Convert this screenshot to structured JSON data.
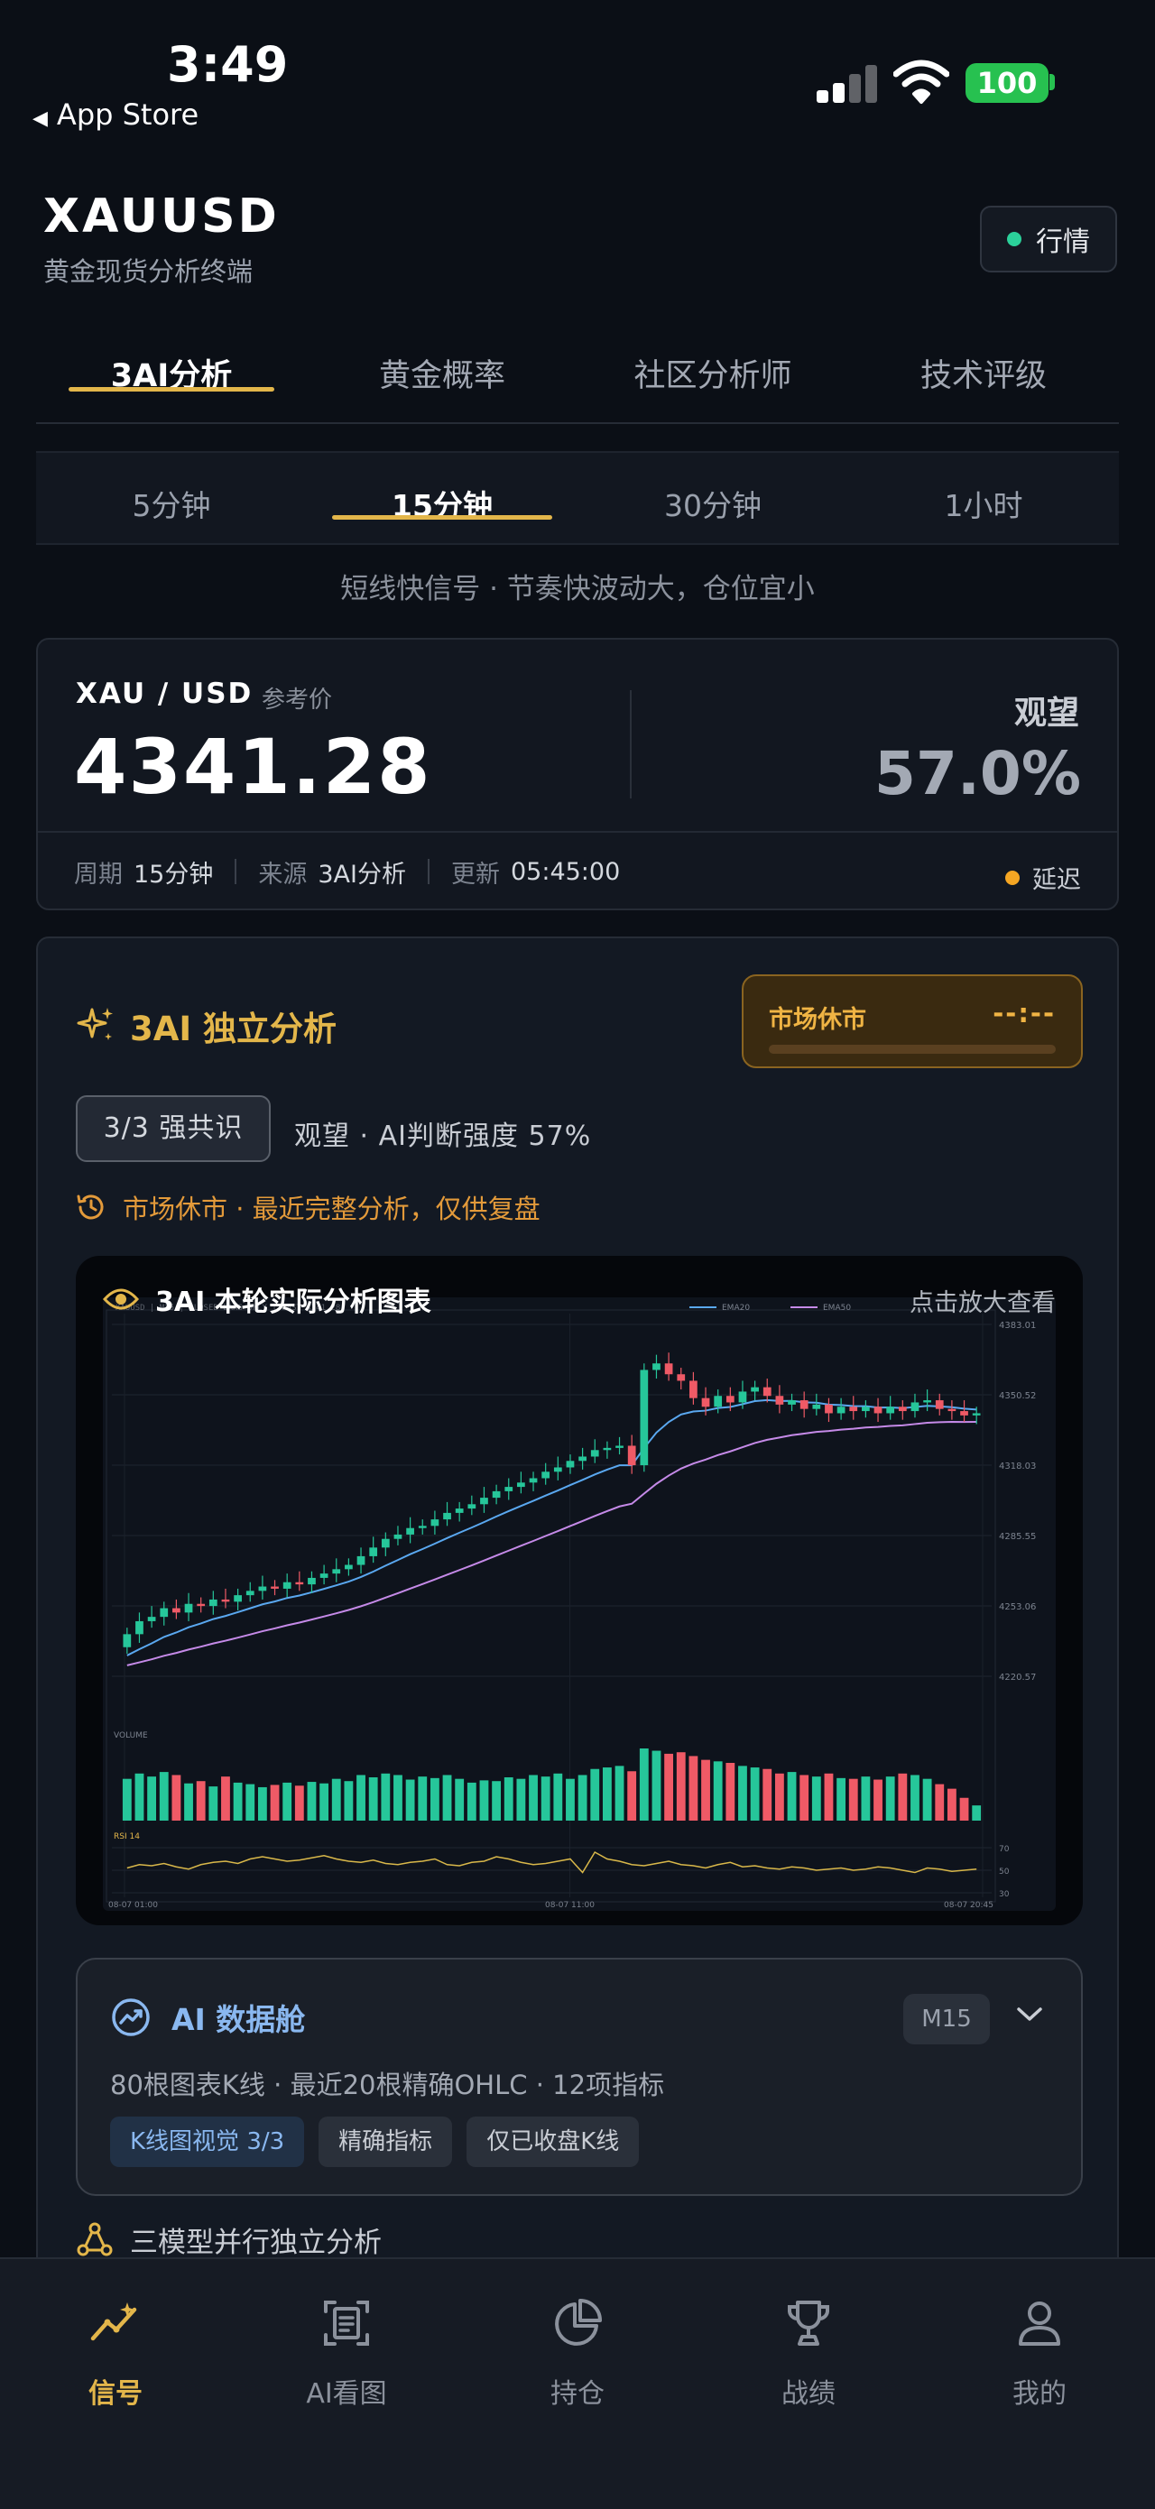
{
  "status_bar": {
    "time": "3:49",
    "back_label": "App Store",
    "battery": "100"
  },
  "header": {
    "symbol": "XAUUSD",
    "subtitle": "黄金现货分析终端",
    "market_button": "行情"
  },
  "main_tabs": [
    {
      "label": "3AI分析",
      "active": true
    },
    {
      "label": "黄金概率",
      "active": false
    },
    {
      "label": "社区分析师",
      "active": false
    },
    {
      "label": "技术评级",
      "active": false
    }
  ],
  "period_tabs": [
    {
      "label": "5分钟",
      "active": false
    },
    {
      "label": "15分钟",
      "active": true
    },
    {
      "label": "30分钟",
      "active": false
    },
    {
      "label": "1小时",
      "active": false
    }
  ],
  "period_hint": "短线快信号 · 节奏快波动大，仓位宜小",
  "price_card": {
    "pair": "XAU / USD",
    "ref_label": "参考价",
    "price": "4341.28",
    "stance": "观望",
    "probability": "57.0%",
    "period_label": "周期",
    "period_value": "15分钟",
    "source_label": "来源",
    "source_value": "3AI分析",
    "updated_label": "更新",
    "updated_value": "05:45:00",
    "delay_label": "延迟"
  },
  "analysis": {
    "title": "3AI 独立分析",
    "market_closed_label": "市场休市",
    "countdown": "--:--",
    "consensus_badge": "3/3 强共识",
    "judgement": "观望 · AI判断强度 57%",
    "closed_note": "市场休市 · 最近完整分析，仅供复盘",
    "chart_title": "3AI 本轮实际分析图表",
    "chart_zoom_hint": "点击放大查看",
    "data_card": {
      "title": "AI 数据舱",
      "badge": "M15",
      "subtitle": "80根图表K线 · 最近20根精确OHLC · 12项指标",
      "tags": [
        "K线图视觉 3/3",
        "精确指标",
        "仅已收盘K线"
      ]
    },
    "three_model_title": "三模型并行独立分析"
  },
  "chart_data": {
    "type": "candlestick",
    "header_text": "XAUUSD | M15 | CLOSED BARS ONLY | LAST 4341.28",
    "legend": [
      "EMA20",
      "EMA50"
    ],
    "y_ticks": [
      "4383.01",
      "4350.52",
      "4318.03",
      "4285.55",
      "4253.06",
      "4220.57"
    ],
    "ylim": [
      4220.57,
      4383.01
    ],
    "x_ticks": [
      "08-07 01:00",
      "08-07 11:00",
      "08-07 20:45"
    ],
    "volume_label": "VOLUME",
    "rsi_label": "RSI 14",
    "rsi_ticks": [
      "70",
      "50",
      "30"
    ],
    "closes": [
      4240,
      4246,
      4248,
      4252,
      4250,
      4254,
      4253,
      4256,
      4255,
      4258,
      4260,
      4262,
      4261,
      4264,
      4263,
      4266,
      4268,
      4270,
      4272,
      4276,
      4280,
      4284,
      4286,
      4289,
      4290,
      4293,
      4296,
      4298,
      4300,
      4303,
      4306,
      4308,
      4310,
      4312,
      4315,
      4317,
      4320,
      4322,
      4325,
      4326,
      4327,
      4318,
      4362,
      4365,
      4360,
      4357,
      4349,
      4345,
      4350,
      4347,
      4352,
      4354,
      4350,
      4346,
      4348,
      4344,
      4346,
      4342,
      4345,
      4343,
      4345,
      4342,
      4345,
      4343,
      4347,
      4348,
      4344,
      4343,
      4341,
      4342
    ],
    "volume": [
      55,
      62,
      58,
      64,
      60,
      49,
      52,
      45,
      58,
      50,
      48,
      44,
      47,
      50,
      46,
      51,
      49,
      55,
      52,
      60,
      57,
      62,
      60,
      54,
      58,
      56,
      60,
      55,
      50,
      53,
      52,
      57,
      55,
      60,
      58,
      62,
      55,
      60,
      68,
      70,
      72,
      65,
      95,
      92,
      88,
      90,
      85,
      80,
      78,
      76,
      72,
      70,
      68,
      62,
      64,
      60,
      58,
      62,
      56,
      55,
      58,
      54,
      58,
      62,
      60,
      55,
      48,
      42,
      30,
      20
    ],
    "rsi": [
      52,
      55,
      54,
      56,
      53,
      51,
      55,
      57,
      58,
      56,
      60,
      62,
      60,
      58,
      59,
      61,
      63,
      60,
      58,
      57,
      59,
      56,
      55,
      57,
      58,
      60,
      55,
      54,
      57,
      58,
      62,
      60,
      57,
      55,
      56,
      58,
      60,
      48,
      66,
      60,
      58,
      55,
      54,
      56,
      58,
      55,
      54,
      52,
      55,
      57,
      53,
      54,
      52,
      51,
      53,
      52,
      50,
      51,
      52,
      50,
      51,
      53,
      52,
      50,
      48,
      52,
      51,
      49,
      50,
      51
    ]
  },
  "bottom_nav": [
    {
      "label": "信号",
      "icon": "signal-chart-icon",
      "active": true
    },
    {
      "label": "AI看图",
      "icon": "scan-document-icon",
      "active": false
    },
    {
      "label": "持仓",
      "icon": "pie-chart-icon",
      "active": false
    },
    {
      "label": "战绩",
      "icon": "trophy-icon",
      "active": false
    },
    {
      "label": "我的",
      "icon": "user-icon",
      "active": false
    }
  ]
}
